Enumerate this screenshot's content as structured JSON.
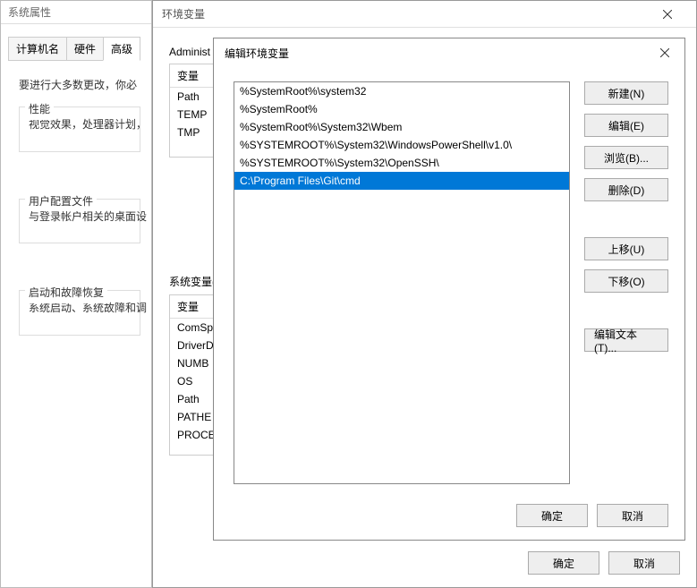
{
  "sysprops": {
    "title": "系统属性",
    "tabs": [
      "计算机名",
      "硬件",
      "高级"
    ],
    "active_tab": 2,
    "intro": "要进行大多数更改，你必",
    "perf": {
      "legend": "性能",
      "text": "视觉效果，处理器计划，"
    },
    "userprofile": {
      "legend": "用户配置文件",
      "text": "与登录帐户相关的桌面设"
    },
    "startup": {
      "legend": "启动和故障恢复",
      "text": "系统启动、系统故障和调"
    }
  },
  "env": {
    "title": "环境变量",
    "user_section_label": "Administ",
    "user_vars_header": "变量",
    "user_vars": [
      "Path",
      "TEMP",
      "TMP"
    ],
    "sys_section_label": "系统变量(",
    "sys_vars_header": "变量",
    "sys_vars": [
      "ComSp",
      "DriverD",
      "NUMB",
      "OS",
      "Path",
      "PATHE",
      "PROCE"
    ],
    "ok": "确定",
    "cancel": "取消"
  },
  "edit": {
    "title": "编辑环境变量",
    "entries": [
      "%SystemRoot%\\system32",
      "%SystemRoot%",
      "%SystemRoot%\\System32\\Wbem",
      "%SYSTEMROOT%\\System32\\WindowsPowerShell\\v1.0\\",
      "%SYSTEMROOT%\\System32\\OpenSSH\\",
      "C:\\Program Files\\Git\\cmd"
    ],
    "selected_index": 5,
    "buttons": {
      "new": "新建(N)",
      "edit": "编辑(E)",
      "browse": "浏览(B)...",
      "delete": "删除(D)",
      "up": "上移(U)",
      "down": "下移(O)",
      "edit_text": "编辑文本(T)..."
    },
    "ok": "确定",
    "cancel": "取消"
  }
}
